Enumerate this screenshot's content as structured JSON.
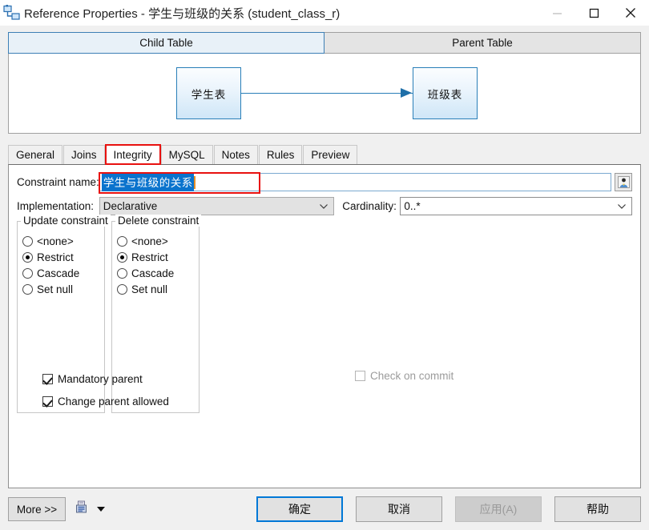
{
  "window": {
    "title": "Reference Properties - 学生与班级的关系 (student_class_r)",
    "app_icon": "reference-relationship-icon",
    "minimize_label": "minimize-icon",
    "maximize_label": "maximize-icon",
    "close_label": "close-icon"
  },
  "diagram": {
    "table_tabs": [
      {
        "label": "Child Table",
        "selected": true
      },
      {
        "label": "Parent Table",
        "selected": false
      }
    ],
    "child_entity": "学生表",
    "parent_entity": "班级表",
    "connector": "arrow-right-icon"
  },
  "tabs": [
    {
      "label": "General",
      "selected": false
    },
    {
      "label": "Joins",
      "selected": false
    },
    {
      "label": "Integrity",
      "selected": true
    },
    {
      "label": "MySQL",
      "selected": false
    },
    {
      "label": "Notes",
      "selected": false
    },
    {
      "label": "Rules",
      "selected": false
    },
    {
      "label": "Preview",
      "selected": false
    }
  ],
  "form": {
    "constraint_name_label": "Constraint name:",
    "constraint_name_value": "学生与班级的关系",
    "constraint_name_picker_icon": "user-picker-icon",
    "implementation_label": "Implementation:",
    "implementation_value": "Declarative",
    "cardinality_label": "Cardinality:",
    "cardinality_value": "0..*"
  },
  "update_constraint": {
    "legend": "Update constraint",
    "options": [
      {
        "label": "<none>",
        "selected": false
      },
      {
        "label": "Restrict",
        "selected": true
      },
      {
        "label": "Cascade",
        "selected": false
      },
      {
        "label": "Set null",
        "selected": false
      }
    ]
  },
  "delete_constraint": {
    "legend": "Delete constraint",
    "options": [
      {
        "label": "<none>",
        "selected": false
      },
      {
        "label": "Restrict",
        "selected": true
      },
      {
        "label": "Cascade",
        "selected": false
      },
      {
        "label": "Set null",
        "selected": false
      }
    ]
  },
  "checkboxes": {
    "mandatory_parent": {
      "label": "Mandatory parent",
      "checked": true,
      "disabled": false
    },
    "change_parent_allowed": {
      "label": "Change parent allowed",
      "checked": true,
      "disabled": false
    },
    "check_on_commit": {
      "label": "Check on commit",
      "checked": false,
      "disabled": true
    }
  },
  "footer": {
    "more_label": "More >>",
    "print_icon": "print-report-icon",
    "print_dropdown_icon": "chevron-down-icon",
    "ok_label": "确定",
    "cancel_label": "取消",
    "apply_label": "应用(A)",
    "apply_disabled": true,
    "help_label": "帮助"
  },
  "colors": {
    "accent": "#0078d7",
    "annotation": "#e8110f",
    "selection": "#0a73cd",
    "entity_border": "#2a7fb8"
  }
}
